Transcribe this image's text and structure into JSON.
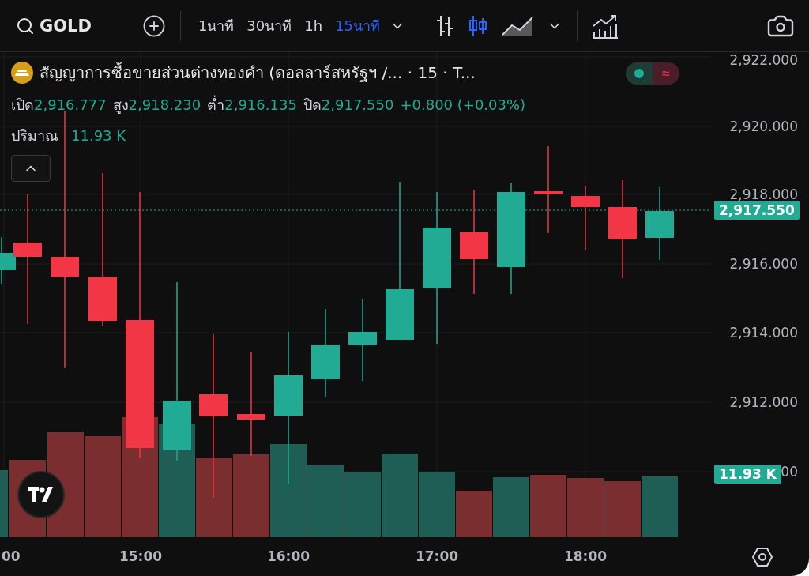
{
  "toolbar": {
    "symbol": "GOLD",
    "intervals": [
      {
        "label": "1นาที",
        "selected": false
      },
      {
        "label": "30นาที",
        "selected": false
      },
      {
        "label": "1h",
        "selected": false
      },
      {
        "label": "15นาที",
        "selected": true
      }
    ],
    "chart_types": [
      {
        "kind": "bars",
        "selected": false
      },
      {
        "kind": "candles",
        "selected": true
      },
      {
        "kind": "area",
        "selected": false
      }
    ]
  },
  "legend": {
    "title": "สัญญาการซื้อขายส่วนต่างทองคำ (ดอลลาร์สหรัฐฯ /... · 15 · T...",
    "toggle": "≈",
    "ohlc": [
      {
        "label": "เปิด",
        "value": "2,916.777"
      },
      {
        "label": "สูง",
        "value": "2,918.230"
      },
      {
        "label": "ต่ำ",
        "value": "2,916.135"
      },
      {
        "label": "ปิด",
        "value": "2,917.550"
      }
    ],
    "change": "+0.800 (+0.03%)",
    "volume": {
      "label": "ปริมาณ",
      "value": "11.93 K"
    }
  },
  "price_axis": {
    "ticks": [
      "2,922.000",
      "2,920.000",
      "2,918.000",
      "2,916.000",
      "2,914.000",
      "2,912.000",
      "00"
    ],
    "last_price": "2,917.550",
    "last_volume": "11.93 K"
  },
  "time_axis": {
    "ticks": [
      "00",
      "15:00",
      "16:00",
      "17:00",
      "18:00"
    ]
  }
}
